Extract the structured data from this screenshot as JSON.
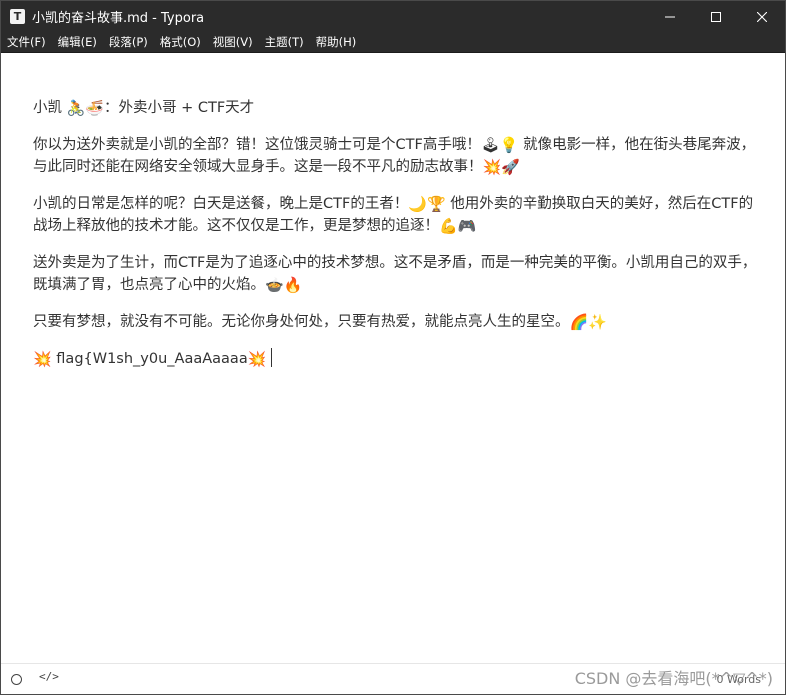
{
  "window": {
    "app_icon": "T",
    "title": "小凯的奋斗故事.md - Typora"
  },
  "menu": {
    "items": [
      "文件(F)",
      "编辑(E)",
      "段落(P)",
      "格式(O)",
      "视图(V)",
      "主题(T)",
      "帮助(H)"
    ]
  },
  "document": {
    "p1": {
      "a": "小凯 ",
      "e1": "🚴",
      "e2": "🍜",
      "b": "：外卖小哥 + CTF天才"
    },
    "p2": {
      "a": "你以为送外卖就是小凯的全部？错！这位饿灵骑士可是个CTF高手哦！",
      "e1": "🕹",
      "e2": "💡",
      "b": " 就像电影一样，他在街头巷尾奔波，与此同时还能在网络安全领域大显身手。这是一段不平凡的励志故事！",
      "e3": "💥",
      "e4": "🚀"
    },
    "p3": {
      "a": "小凯的日常是怎样的呢？白天是送餐，晚上是CTF的王者！",
      "e1": "🌙",
      "e2": "🏆",
      "b": " 他用外卖的辛勤换取白天的美好，然后在CTF的战场上释放他的技术才能。这不仅仅是工作，更是梦想的追逐！",
      "e3": "💪",
      "e4": "🎮"
    },
    "p4": {
      "a": "送外卖是为了生计，而CTF是为了追逐心中的技术梦想。这不是矛盾，而是一种完美的平衡。小凯用自己的双手，既填满了胃，也点亮了心中的火焰。",
      "e1": "🍲",
      "e2": "🔥"
    },
    "p5": {
      "a": "只要有梦想，就没有不可能。无论你身处何处，只要有热爱，就能点亮人生的星空。",
      "e1": "🌈",
      "e2": "✨"
    },
    "p6": {
      "e1": "💥",
      "a": " flag{W1sh_y0u_AaaAaaaa",
      "e2": "💥"
    }
  },
  "status": {
    "code_toggle": "</>",
    "word_count": "0 Words"
  },
  "watermark": "CSDN @去看海吧(*^▽^*)",
  "icons": {
    "minimize": "minimize-icon",
    "maximize": "maximize-icon",
    "close": "close-icon",
    "sidebar_toggle": "circle-icon",
    "source_mode": "code-icon"
  }
}
